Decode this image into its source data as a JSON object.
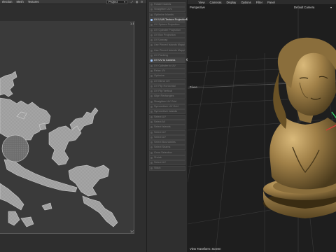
{
  "uv_editor": {
    "menu": [
      "election",
      "Mesh",
      "Textures"
    ],
    "project_select": "Project",
    "tool_icons": [
      "expand-icon",
      "grid-icon",
      "settings-icon"
    ],
    "corner_labels": [
      "1,1",
      "1,0"
    ]
  },
  "tools": {
    "items": [
      {
        "label": "Rotate Islands",
        "active": false
      },
      {
        "label": "Straighten UVs",
        "active": false
      },
      {
        "label": "Optimize Islands",
        "active": false
      },
      {
        "label": "UV UVW Texture Projection",
        "active": true
      },
      {
        "label": "UV Sphere Projection",
        "active": false
      },
      {
        "label": "UV Cylinder Projection",
        "active": false
      },
      {
        "label": "UV Box Projection",
        "active": false
      },
      {
        "label": "UV Unwrap",
        "active": false
      },
      {
        "label": "Use Pinned Islands Mapping",
        "active": false
      },
      {
        "label": "Use Pinned Islands Mapping",
        "active": false
      },
      {
        "label": "UV Packing",
        "active": false
      },
      {
        "label": "UV UV to Camera",
        "active": true
      },
      {
        "label": "UV Cylinder to UV",
        "active": false
      },
      {
        "label": "Relax UV",
        "active": false
      },
      {
        "label": "Optimize",
        "active": false
      },
      {
        "label": "UV Mirror UV",
        "active": false
      },
      {
        "label": "UV Flip Horizontal",
        "active": false
      },
      {
        "label": "UV Flip Vertical",
        "active": false
      },
      {
        "label": "Align Rectangles",
        "active": false
      },
      {
        "label": "Straighten UV Grid",
        "active": false
      },
      {
        "label": "Symmetrize UV Grid",
        "active": false
      },
      {
        "label": "Symmetrize Islands",
        "active": false
      },
      {
        "label": "Select UV",
        "active": false
      },
      {
        "label": "Select All",
        "active": false
      },
      {
        "label": "Select Islands",
        "active": false
      },
      {
        "label": "Select UV",
        "active": false
      },
      {
        "label": "Select UV",
        "active": false
      },
      {
        "label": "Select Boundaries",
        "active": false
      },
      {
        "label": "Select Seams",
        "active": false
      },
      {
        "label": "Grow Selection",
        "active": false
      },
      {
        "label": "Shrink",
        "active": false
      },
      {
        "label": "Select UV",
        "active": false
      },
      {
        "label": "Stitch",
        "active": false
      }
    ]
  },
  "viewport": {
    "menu": [
      "View",
      "Cameras",
      "Display",
      "Options",
      "Filter",
      "Panel"
    ],
    "projection": "Perspective",
    "camera": "Default Camera",
    "plane_label": "Plane",
    "bottom_label": "View Transform: Screen",
    "colors": {
      "bust": "#8a6e3c",
      "bust_highlight": "#c9a86a",
      "bust_shadow": "#4a3a1c",
      "grid": "#3a3a3a"
    }
  }
}
